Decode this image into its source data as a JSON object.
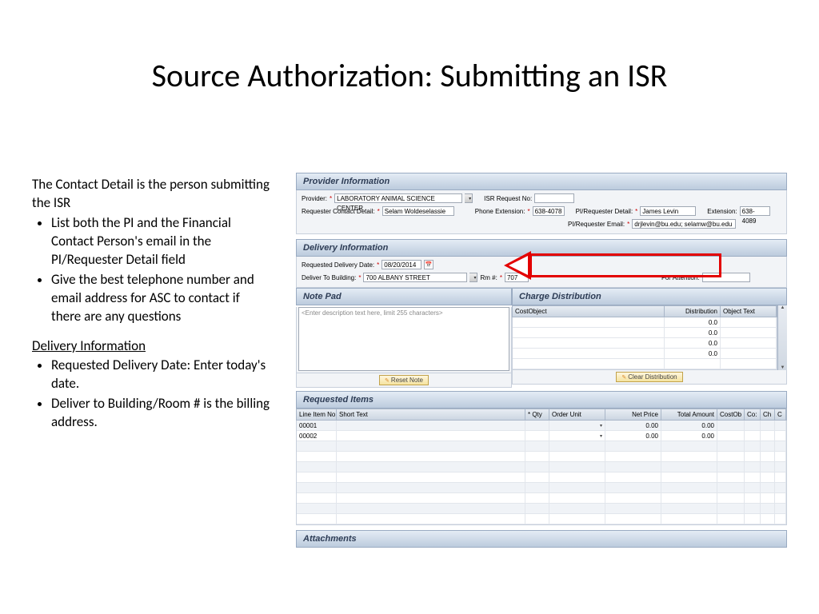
{
  "title": "Source Authorization: Submitting an ISR",
  "left": {
    "intro": "The Contact Detail is the person submitting the ISR",
    "bullets1": [
      "List both the PI and the Financial Contact Person's email in the PI/Requester Detail field",
      "Give the best telephone number and email address for ASC to contact if there are any questions"
    ],
    "subhead": "Delivery Information",
    "bullets2": [
      "Requested Delivery Date: Enter today's date.",
      "Deliver to Building/Room # is the billing address."
    ]
  },
  "provider": {
    "header": "Provider Information",
    "provider_label": "Provider:",
    "provider_value": "LABORATORY ANIMAL SCIENCE CENTER",
    "isr_label": "ISR Request No:",
    "isr_value": "",
    "contact_label": "Requester Contact Detail:",
    "contact_value": "Selam Woldeselassie",
    "phone_label": "Phone Extension:",
    "phone_value": "638-4078",
    "pi_label": "PI/Requester Detail:",
    "pi_value": "James Levin",
    "ext_label": "Extension:",
    "ext_value": "638-4089",
    "pi_email_label": "PI/Requester Email:",
    "pi_email_value": "drjlevin@bu.edu; selamw@bu.edu"
  },
  "delivery": {
    "header": "Delivery Information",
    "date_label": "Requested Delivery Date:",
    "date_value": "08/20/2014",
    "bldg_label": "Deliver To Building:",
    "bldg_value": "700 ALBANY STREET",
    "room_label": "Rm #:",
    "room_value": "707",
    "attn_label": "For Attention:",
    "attn_value": ""
  },
  "notepad": {
    "header": "Note Pad",
    "placeholder": "<Enter description text here, limit 255 characters>",
    "reset": "Reset Note"
  },
  "charge": {
    "header": "Charge Distribution",
    "col_cost": "CostObject",
    "col_dist": "Distribution",
    "col_obj": "Object Text",
    "rows": [
      "0.0",
      "0.0",
      "0.0",
      "0.0"
    ],
    "clear": "Clear Distribution"
  },
  "requested": {
    "header": "Requested Items",
    "cols": {
      "line": "Line Item No",
      "short": "Short Text",
      "qty": "* Qty",
      "unit": "Order Unit",
      "net": "Net Price",
      "total": "Total Amount",
      "costob": "CostOb",
      "cos": "Co:",
      "ch": "Ch",
      "c": "C"
    },
    "rows": [
      {
        "no": "00001",
        "net": "0.00",
        "total": "0.00"
      },
      {
        "no": "00002",
        "net": "0.00",
        "total": "0.00"
      }
    ]
  },
  "attachments": {
    "header": "Attachments"
  }
}
